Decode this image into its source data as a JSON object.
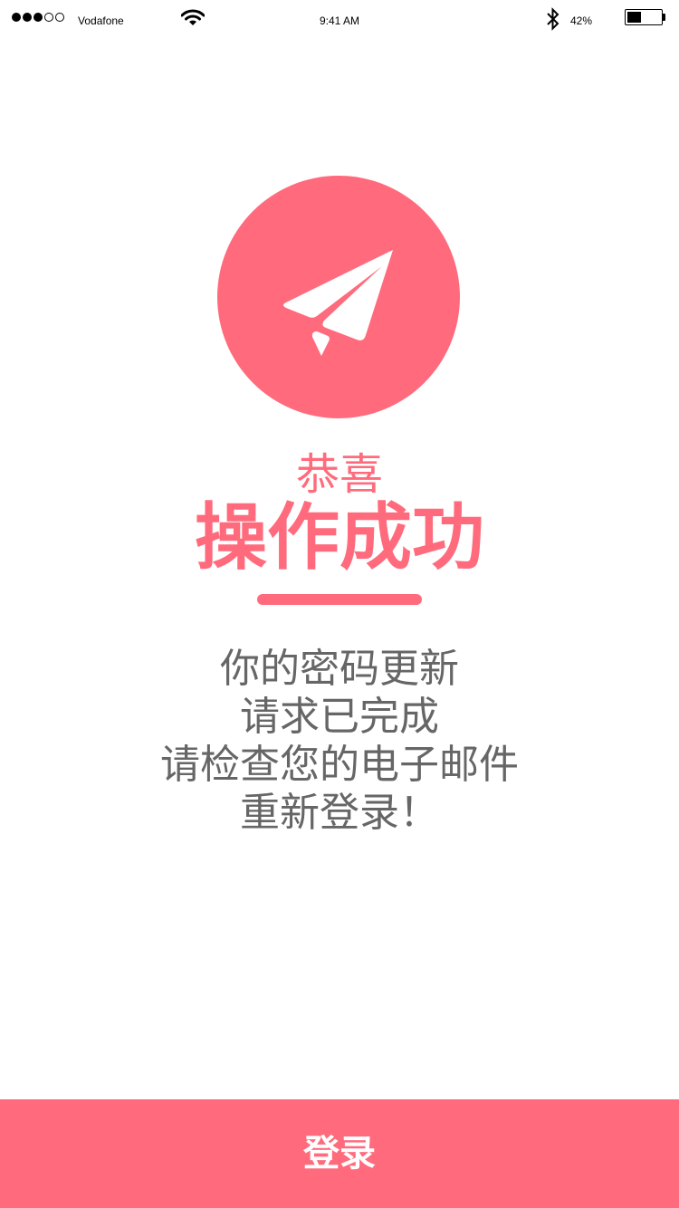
{
  "status_bar": {
    "carrier": "Vodafone",
    "time": "9:41 AM",
    "battery_percent_label": "42%",
    "battery_level": 0.42,
    "signal_bars_filled": 3,
    "signal_bars_total": 5
  },
  "hero": {
    "icon": "paper-plane-icon",
    "circle_color": "#ff6b7d"
  },
  "header": {
    "subtitle": "恭喜",
    "title": "操作成功"
  },
  "message": {
    "lines": [
      "你的密码更新",
      "请求已完成",
      "请检查您的电子邮件",
      "重新登录！"
    ]
  },
  "actions": {
    "login_label": "登录"
  },
  "colors": {
    "accent": "#ff6b7d",
    "text_gray": "#666666"
  }
}
